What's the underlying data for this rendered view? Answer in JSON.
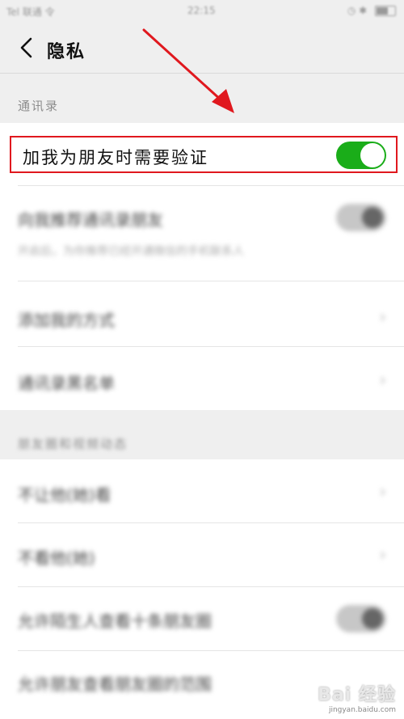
{
  "statusbar": {
    "carrier": "Tel 联通 令",
    "time": "22:15",
    "indicators": "◷ ✱"
  },
  "navbar": {
    "title": "隐私"
  },
  "sections": {
    "contacts": {
      "header": "通讯录"
    },
    "moments": {
      "header": "朋友圈和视频动态"
    }
  },
  "settings": {
    "verify_friend": {
      "label": "加我为朋友时需要验证",
      "enabled": true
    }
  },
  "blurred_rows": [
    {
      "label": "向我推荐通讯录朋友",
      "sub": "开启后，为你推荐已经开通微信的手机联系人"
    },
    {
      "label": "添加我的方式"
    },
    {
      "label": "通讯录黑名单"
    },
    {
      "label": "不让他(她)看"
    },
    {
      "label": "不看他(她)"
    },
    {
      "label": "允许陌生人查看十条朋友圈"
    },
    {
      "label": "允许朋友查看朋友圈的范围"
    }
  ],
  "colors": {
    "toggle_on": "#1aad19",
    "highlight": "#e0181e",
    "arrow": "#e0181e"
  },
  "watermark": {
    "logo": "Bai 经验",
    "url": "jingyan.baidu.com"
  }
}
